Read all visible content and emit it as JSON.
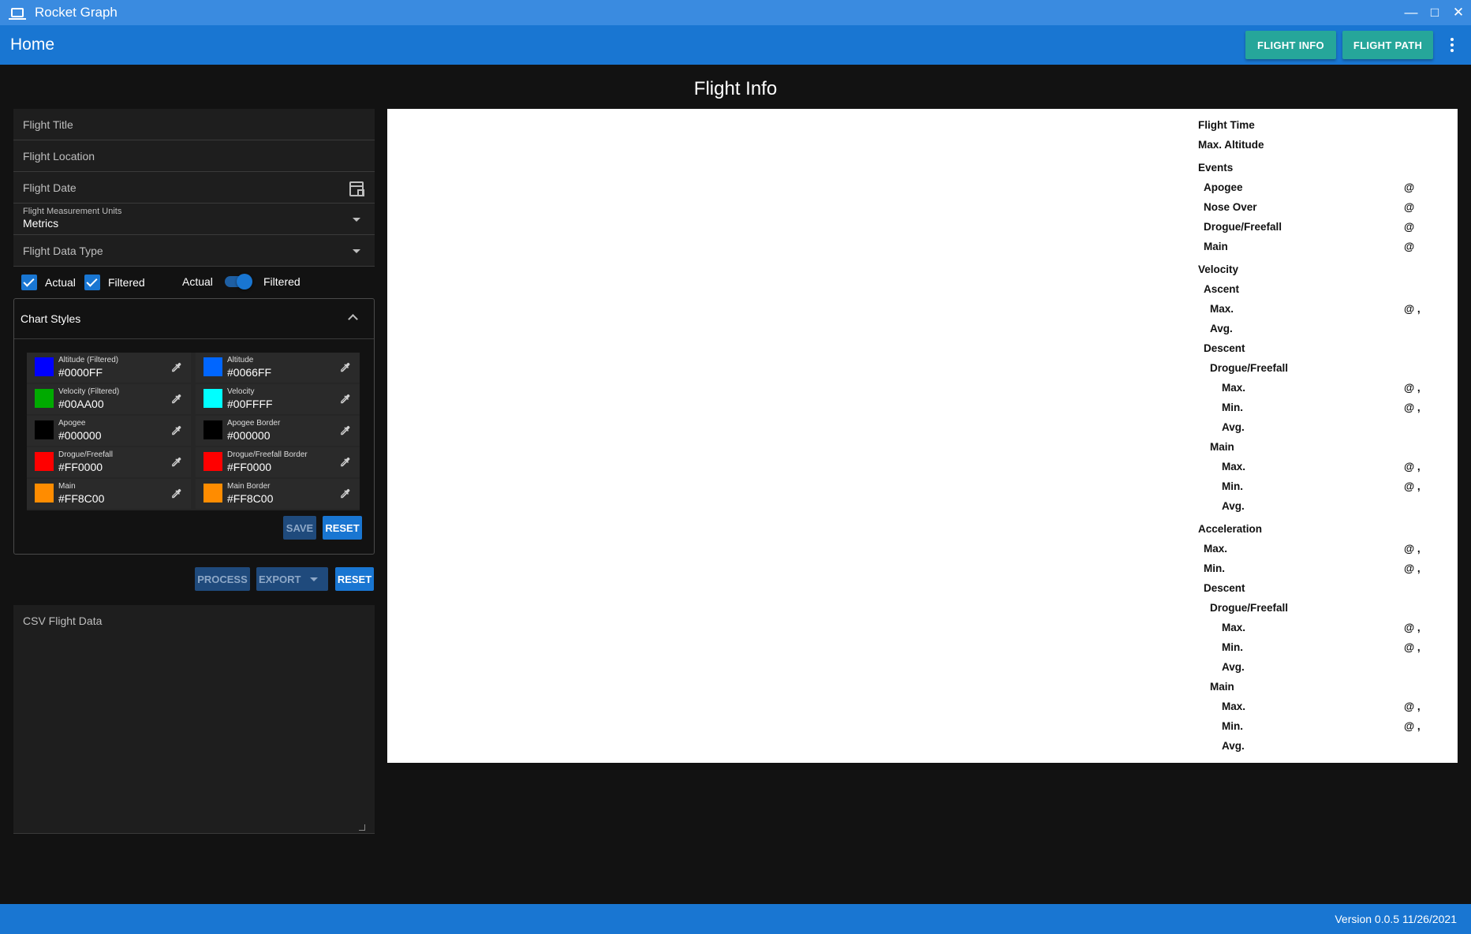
{
  "window": {
    "title": "Rocket Graph",
    "icon": "laptop-icon"
  },
  "appbar": {
    "title": "Home",
    "flight_info_btn": "FLIGHT INFO",
    "flight_path_btn": "FLIGHT PATH"
  },
  "page": {
    "title": "Flight Info"
  },
  "form": {
    "flight_title_label": "Flight Title",
    "flight_location_label": "Flight Location",
    "flight_date_label": "Flight Date",
    "units_label": "Flight Measurement Units",
    "units_value": "Metrics",
    "data_type_label": "Flight Data Type",
    "actual_label": "Actual",
    "filtered_label": "Filtered",
    "toggle_left": "Actual",
    "toggle_right": "Filtered"
  },
  "chart_styles": {
    "title": "Chart Styles",
    "swatches": [
      {
        "name": "Altitude (Filtered)",
        "hex": "#0000FF"
      },
      {
        "name": "Altitude",
        "hex": "#0066FF"
      },
      {
        "name": "Velocity (Filtered)",
        "hex": "#00AA00"
      },
      {
        "name": "Velocity",
        "hex": "#00FFFF"
      },
      {
        "name": "Apogee",
        "hex": "#000000"
      },
      {
        "name": "Apogee Border",
        "hex": "#000000"
      },
      {
        "name": "Drogue/Freefall",
        "hex": "#FF0000"
      },
      {
        "name": "Drogue/Freefall Border",
        "hex": "#FF0000"
      },
      {
        "name": "Main",
        "hex": "#FF8C00"
      },
      {
        "name": "Main Border",
        "hex": "#FF8C00"
      }
    ],
    "save_label": "SAVE",
    "reset_label": "RESET"
  },
  "actions": {
    "process": "PROCESS",
    "export": "EXPORT",
    "reset": "RESET"
  },
  "csv": {
    "label": "CSV Flight Data"
  },
  "stats": {
    "flight_time": "Flight Time",
    "max_altitude": "Max. Altitude",
    "events": "Events",
    "apogee": "Apogee",
    "nose_over": "Nose Over",
    "drogue_freefall": "Drogue/Freefall",
    "main": "Main",
    "velocity": "Velocity",
    "ascent": "Ascent",
    "max": "Max.",
    "min": "Min.",
    "avg": "Avg.",
    "descent": "Descent",
    "acceleration": "Acceleration",
    "at": "@",
    "at_comma": "@ ,"
  },
  "footer": {
    "version": "Version 0.0.5 11/26/2021"
  }
}
